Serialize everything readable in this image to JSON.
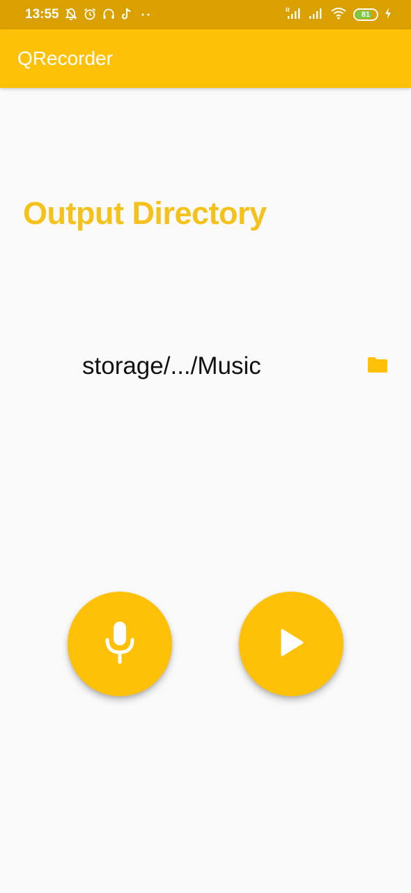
{
  "status_bar": {
    "time": "13:55",
    "battery_level": "81",
    "battery_fraction": 0.81,
    "icons_left": [
      "no-alarm-icon",
      "alarm-clock-icon",
      "headphones-icon",
      "tiktok-icon",
      "more-dots-icon"
    ],
    "icons_right": [
      "signal-r-icon",
      "signal-icon",
      "wifi-icon",
      "battery-icon",
      "charging-icon"
    ]
  },
  "app_bar": {
    "title": "QRecorder"
  },
  "main": {
    "section_title": "Output Directory",
    "output_path": "storage/.../Music",
    "folder_icon": "folder-icon",
    "record_icon": "microphone-icon",
    "play_icon": "play-icon"
  },
  "colors": {
    "status_bar": "#d9a000",
    "app_bar": "#ffc107",
    "accent_text": "#f5c21b",
    "background": "#fafafa"
  }
}
